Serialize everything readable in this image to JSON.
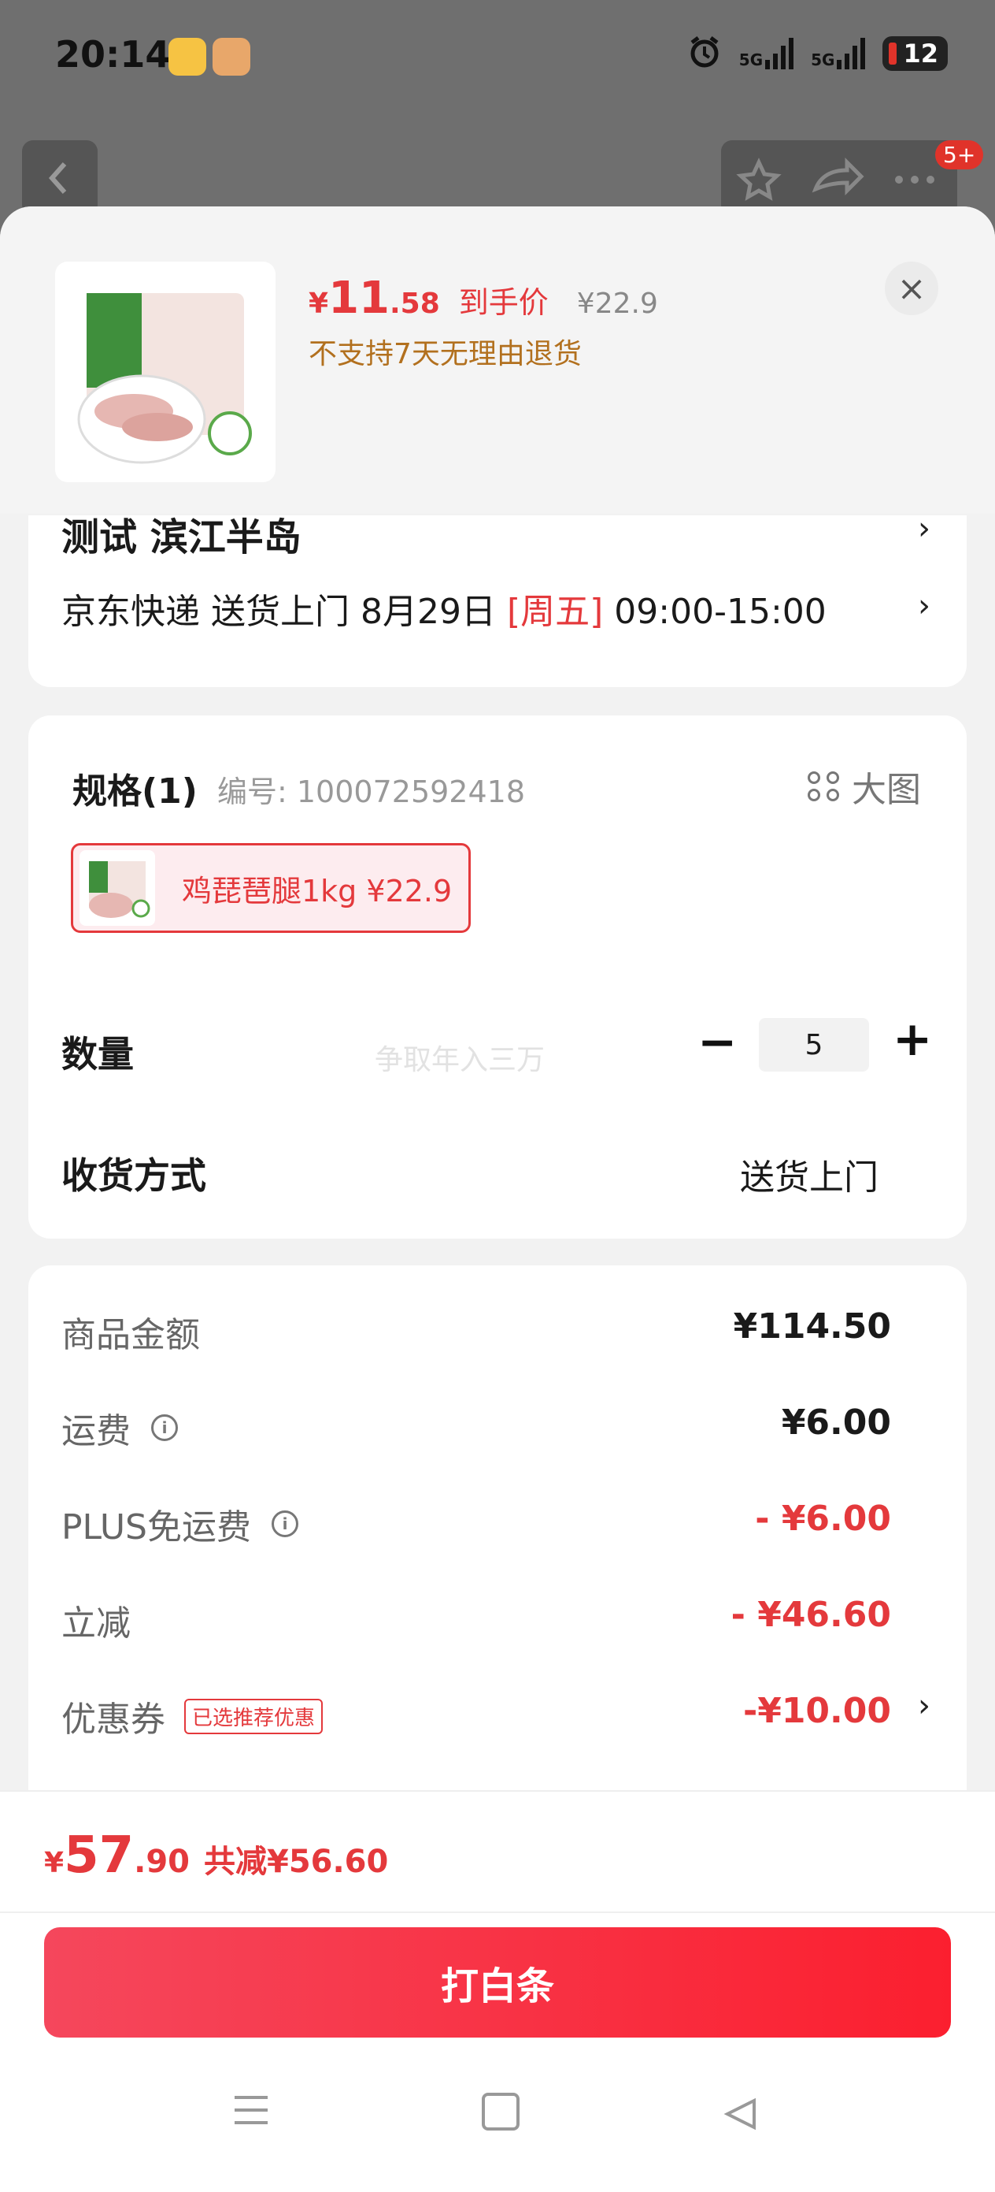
{
  "status_bar": {
    "time": "20:14",
    "network_1": "5G",
    "network_2": "5G",
    "battery": "12"
  },
  "top_nav": {
    "badge": "5+"
  },
  "product": {
    "currency": "¥",
    "price_int": "11",
    "price_dec": ".58",
    "price_label": "到手价",
    "original_price": "¥22.9",
    "return_policy": "不支持7天无理由退货",
    "close_icon": "×"
  },
  "address": {
    "line": "测试  滨江半岛",
    "shipping_prefix": "京东快递 送货上门 8月29日 ",
    "shipping_day": "[周五]",
    "shipping_time": " 09:00-15:00",
    "chevron": "›"
  },
  "spec": {
    "title": "规格(1)",
    "sku_no": "编号: 100072592418",
    "big_image_label": "大图",
    "option_label": "鸡琵琶腿1kg  ¥22.9",
    "quantity_label": "数量",
    "watermark": "争取年入三万",
    "quantity_value": "5",
    "minus": "−",
    "plus": "+",
    "receive_label": "收货方式",
    "receive_value": "送货上门"
  },
  "pricing": {
    "items": [
      {
        "label": "商品金额",
        "value": "¥114.50"
      },
      {
        "label": "运费",
        "value": "¥6.00"
      },
      {
        "label": "PLUS免运费",
        "value": "- ¥6.00"
      },
      {
        "label": "立减",
        "value": "- ¥46.60"
      },
      {
        "label": "优惠券",
        "tag": "已选推荐优惠",
        "value": "-¥10.00"
      }
    ],
    "info_icon": "i"
  },
  "footer": {
    "currency": "¥",
    "total_int": "57",
    "total_dec": ".90",
    "saving": "共减¥56.60",
    "cta": "打白条"
  },
  "colors": {
    "accent": "#e4393c",
    "cta_start": "#f5475c",
    "cta_end": "#fb1f2f"
  }
}
